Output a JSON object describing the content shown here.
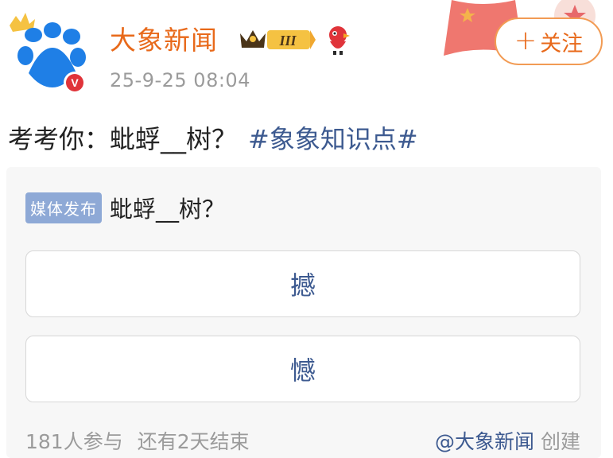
{
  "author": {
    "name": "大象新闻",
    "level_badge": "III",
    "timestamp": "25-9-25 08:04"
  },
  "follow_button": {
    "plus": "+",
    "label": "关注"
  },
  "post": {
    "text": "考考你：蚍蜉__树？",
    "hashtag": "#象象知识点#"
  },
  "poll": {
    "badge": "媒体发布",
    "question": "蚍蜉__树？",
    "options": [
      "撼",
      "憾"
    ],
    "participants": "181人参与",
    "remaining": "还有2天结束",
    "creator": "@大象新闻",
    "creator_suffix": "创建"
  },
  "colors": {
    "name_orange": "#e8691a",
    "link_blue": "#3d5a90",
    "badge_blue": "#8ea9d6",
    "verified_red": "#e0343a",
    "avatar_blue": "#1f7fe6"
  },
  "icons": [
    "crown-icon",
    "verified-icon",
    "mascot-icon",
    "flag-icon"
  ]
}
